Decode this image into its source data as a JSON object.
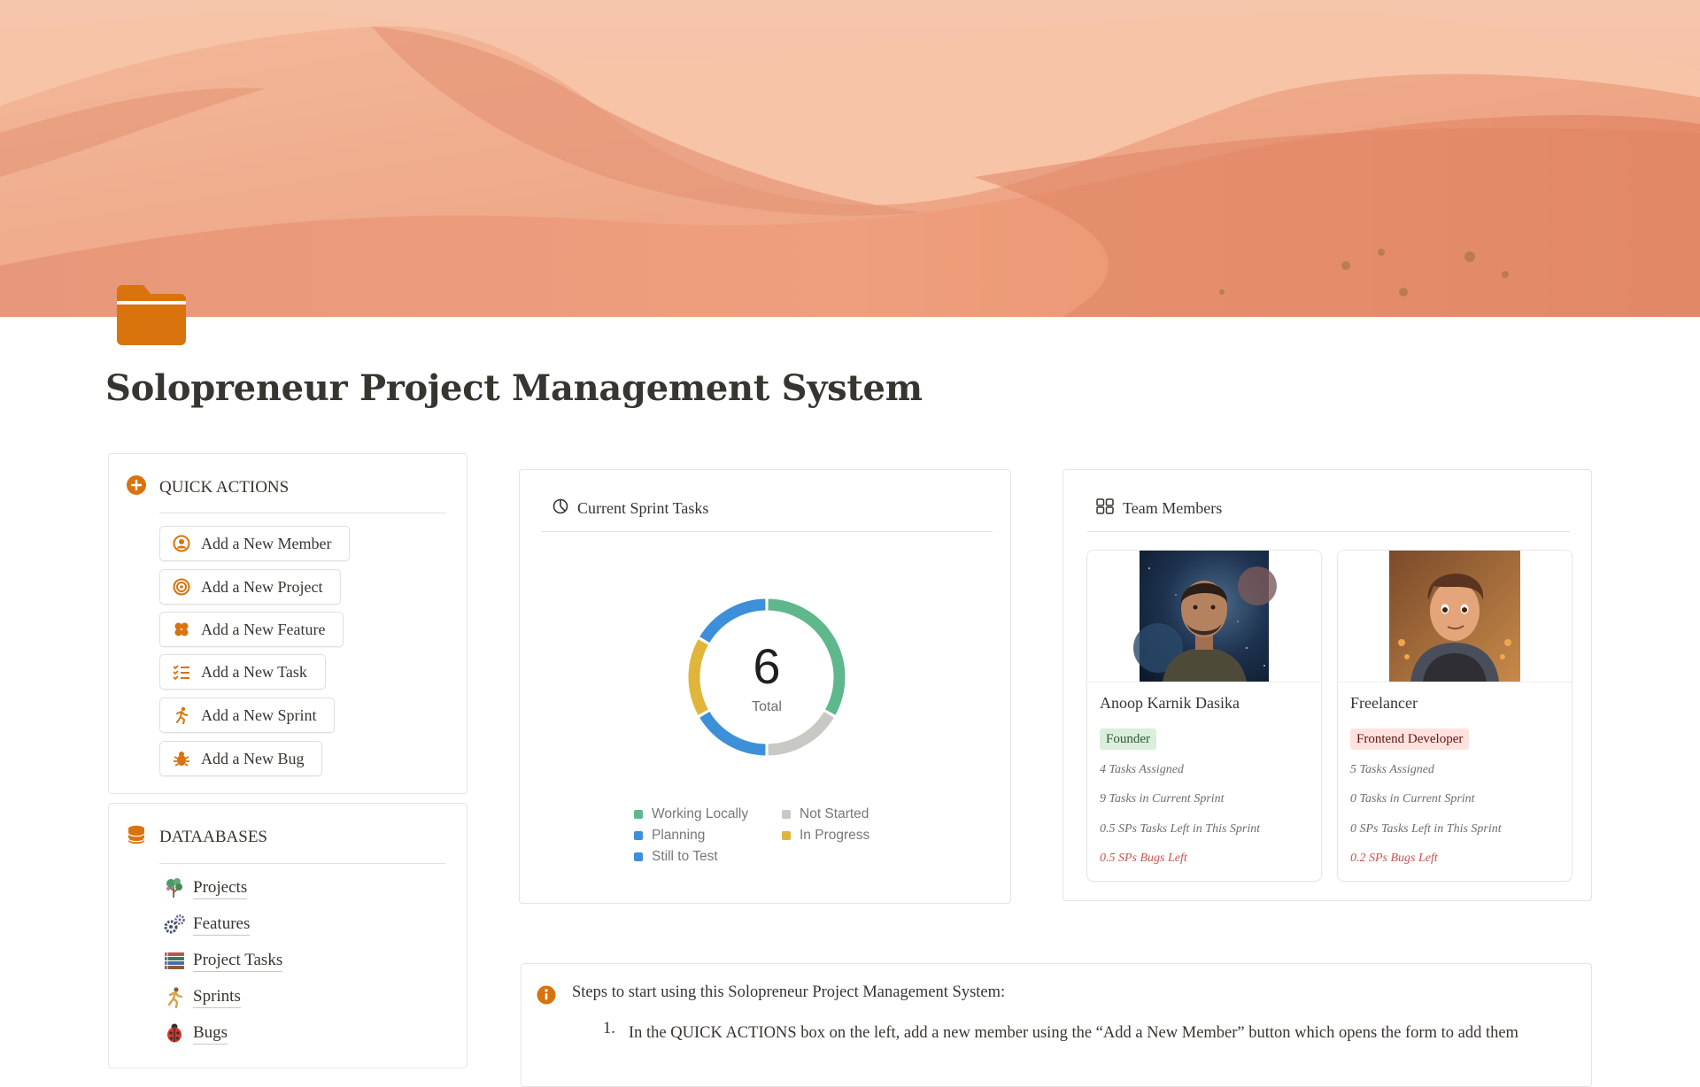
{
  "page": {
    "title": "Solopreneur Project Management System",
    "icon": "folder-icon",
    "accent_color": "#d9730d"
  },
  "quick_actions": {
    "heading": "QUICK ACTIONS",
    "buttons": [
      {
        "label": "Add a New Member",
        "icon": "user-circle-icon"
      },
      {
        "label": "Add a New Project",
        "icon": "target-icon"
      },
      {
        "label": "Add a New Feature",
        "icon": "clover-icon"
      },
      {
        "label": "Add a New Task",
        "icon": "checklist-icon"
      },
      {
        "label": "Add a New Sprint",
        "icon": "running-person-icon"
      },
      {
        "label": "Add a New Bug",
        "icon": "bug-icon"
      }
    ]
  },
  "databases": {
    "heading": "DATAABASES",
    "links": [
      {
        "label": "Projects",
        "icon": "tree-icon"
      },
      {
        "label": "Features",
        "icon": "gears-icon"
      },
      {
        "label": "Project Tasks",
        "icon": "books-icon"
      },
      {
        "label": "Sprints",
        "icon": "runner-icon"
      },
      {
        "label": "Bugs",
        "icon": "ladybug-icon"
      }
    ]
  },
  "sprint_chart": {
    "heading": "Current Sprint Tasks",
    "total": "6",
    "total_label": "Total"
  },
  "chart_data": {
    "type": "pie",
    "title": "Current Sprint Tasks",
    "series": [
      {
        "name": "Working Locally",
        "value": 2,
        "color": "#5fb88c"
      },
      {
        "name": "Not Started",
        "value": 1,
        "color": "#c8c8c5"
      },
      {
        "name": "Planning",
        "value": 1,
        "color": "#3d8fd9"
      },
      {
        "name": "In Progress",
        "value": 1,
        "color": "#e0b53b"
      },
      {
        "name": "Still to Test",
        "value": 1,
        "color": "#3d8fd9"
      }
    ],
    "total": 6,
    "legend_position": "bottom"
  },
  "team": {
    "heading": "Team Members",
    "members": [
      {
        "name": "Anoop Karnik Dasika",
        "role": "Founder",
        "tasks_assigned": "4 Tasks Assigned",
        "tasks_in_sprint": "9 Tasks in Current Sprint",
        "sps_left": "0.5 SPs Tasks Left in This Sprint",
        "bugs_left": "0.5 SPs Bugs Left"
      },
      {
        "name": "Freelancer",
        "role": "Frontend Developer",
        "tasks_assigned": "5 Tasks Assigned",
        "tasks_in_sprint": "0 Tasks in Current Sprint",
        "sps_left": "0 SPs Tasks Left in This Sprint",
        "bugs_left": "0.2 SPs Bugs Left"
      }
    ]
  },
  "callout": {
    "icon": "info-icon",
    "text": "Steps to start using this Solopreneur Project Management System:",
    "step_number": "1.",
    "step_text": "In the QUICK ACTIONS box on the left, add  a new member using the “Add a New Member” button which opens the form to add them"
  }
}
